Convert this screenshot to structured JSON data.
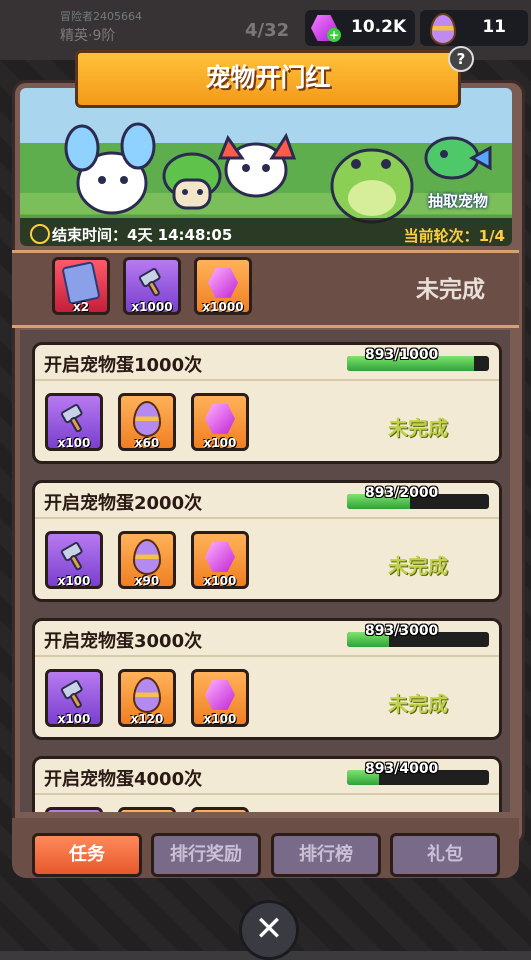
{
  "header": {
    "bg_player_id": "冒险者2405664",
    "bg_rank": "精英·9阶",
    "bg_count": "4/32"
  },
  "currency": {
    "gems": "10.2K",
    "eggs": "11",
    "gem_color": "#c026d3"
  },
  "event": {
    "title": "宠物开门红",
    "end_time_label": "结束时间：4天 14:48:05",
    "round_label": "当前轮次：1/4",
    "draw_pet_label": "抽取宠物"
  },
  "final_reward": {
    "items": [
      {
        "icon": "card-icon",
        "qty": "x2",
        "bg": "red"
      },
      {
        "icon": "hammer-icon",
        "qty": "x1000",
        "bg": "purple"
      },
      {
        "icon": "gem-icon",
        "qty": "x1000",
        "bg": "orange"
      }
    ],
    "status": "未完成"
  },
  "tasks": [
    {
      "name": "开启宠物蛋1000次",
      "progress_text": "893/1000",
      "progress": 0.893,
      "status": "未完成",
      "rewards": [
        {
          "icon": "hammer-icon",
          "qty": "x100",
          "bg": "purple"
        },
        {
          "icon": "egg-icon",
          "qty": "x60",
          "bg": "orange"
        },
        {
          "icon": "gem-icon",
          "qty": "x100",
          "bg": "orange"
        }
      ]
    },
    {
      "name": "开启宠物蛋2000次",
      "progress_text": "893/2000",
      "progress": 0.4465,
      "status": "未完成",
      "rewards": [
        {
          "icon": "hammer-icon",
          "qty": "x100",
          "bg": "purple"
        },
        {
          "icon": "egg-icon",
          "qty": "x90",
          "bg": "orange"
        },
        {
          "icon": "gem-icon",
          "qty": "x100",
          "bg": "orange"
        }
      ]
    },
    {
      "name": "开启宠物蛋3000次",
      "progress_text": "893/3000",
      "progress": 0.2977,
      "status": "未完成",
      "rewards": [
        {
          "icon": "hammer-icon",
          "qty": "x100",
          "bg": "purple"
        },
        {
          "icon": "egg-icon",
          "qty": "x120",
          "bg": "orange"
        },
        {
          "icon": "gem-icon",
          "qty": "x100",
          "bg": "orange"
        }
      ]
    },
    {
      "name": "开启宠物蛋4000次",
      "progress_text": "893/4000",
      "progress": 0.2233,
      "status": "",
      "rewards": [
        {
          "icon": "hammer-icon",
          "qty": "",
          "bg": "purple"
        },
        {
          "icon": "egg-icon",
          "qty": "",
          "bg": "orange"
        },
        {
          "icon": "gem-icon",
          "qty": "",
          "bg": "orange"
        }
      ]
    }
  ],
  "tabs": [
    {
      "label": "任务",
      "active": true
    },
    {
      "label": "排行奖励",
      "active": false
    },
    {
      "label": "排行榜",
      "active": false
    },
    {
      "label": "礼包",
      "active": false
    }
  ],
  "close_icon": "close-icon"
}
